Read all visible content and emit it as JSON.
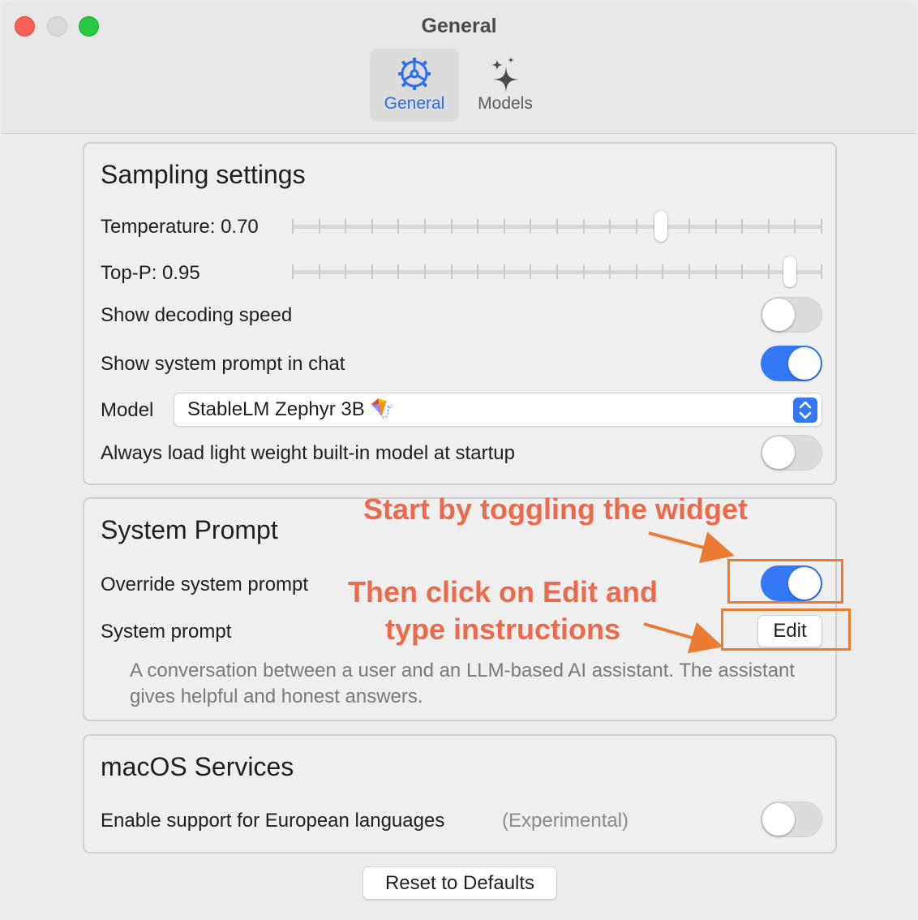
{
  "window": {
    "title": "General",
    "tabs": [
      {
        "label": "General",
        "icon": "gear-icon",
        "selected": true
      },
      {
        "label": "Models",
        "icon": "sparkles-icon",
        "selected": false
      }
    ]
  },
  "sampling": {
    "title": "Sampling settings",
    "temperature_label": "Temperature: 0.70",
    "temperature_value": 0.7,
    "top_p_label": "Top-P: 0.95",
    "top_p_value": 0.95,
    "show_decoding_speed_label": "Show decoding speed",
    "show_decoding_speed": false,
    "show_system_prompt_label": "Show system prompt in chat",
    "show_system_prompt": true,
    "model_label": "Model",
    "model_value": "StableLM Zephyr 3B 🪁",
    "always_load_label": "Always load light weight built-in model at startup",
    "always_load": false
  },
  "system_prompt": {
    "title": "System Prompt",
    "override_label": "Override system prompt",
    "override": true,
    "prompt_label": "System prompt",
    "edit_label": "Edit",
    "prompt_text": "A conversation between a user and an LLM-based AI assistant. The assistant gives helpful and honest answers."
  },
  "services": {
    "title": "macOS Services",
    "european_label": "Enable support for European languages",
    "experimental_label": "(Experimental)",
    "european": false
  },
  "reset_label": "Reset to Defaults",
  "annotations": {
    "step1": "Start by toggling the widget",
    "step2_line1": "Then click on Edit and",
    "step2_line2": "type instructions",
    "color": "#ec6a4c",
    "box_color": "#ea7b33"
  },
  "colors": {
    "accent": "#3478f6",
    "tab_selected_text": "#2c6cf0",
    "close": "#fe5f57",
    "maximize": "#28c840"
  }
}
